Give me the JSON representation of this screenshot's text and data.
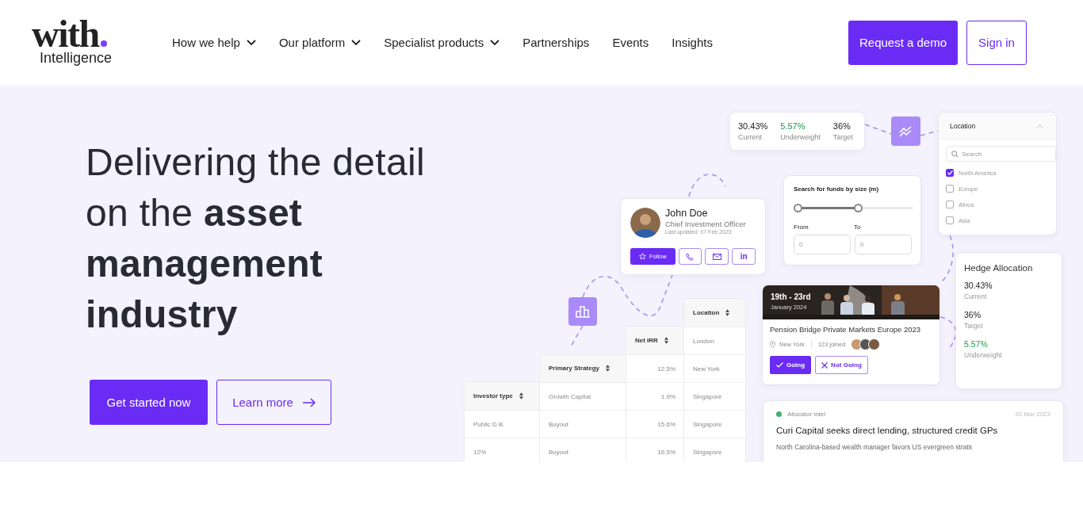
{
  "header": {
    "logo": {
      "word": "with",
      "subtitle": "Intelligence"
    },
    "nav": [
      {
        "label": "How we help",
        "dropdown": true
      },
      {
        "label": "Our platform",
        "dropdown": true
      },
      {
        "label": "Specialist products",
        "dropdown": true
      },
      {
        "label": "Partnerships",
        "dropdown": false
      },
      {
        "label": "Events",
        "dropdown": false
      },
      {
        "label": "Insights",
        "dropdown": false
      }
    ],
    "request_demo": "Request a demo",
    "sign_in": "Sign in"
  },
  "hero": {
    "heading": "Delivering the detail on the **asset management industry**",
    "primary_button": "Get started now",
    "secondary_button": "Learn more"
  },
  "illustration": {
    "stats": [
      {
        "value": "30.43%",
        "label": "Current",
        "highlighted": false
      },
      {
        "value": "5.57%",
        "label": "Underweight",
        "highlighted": true
      },
      {
        "value": "36%",
        "label": "Target",
        "highlighted": false
      }
    ],
    "location_filter": {
      "title": "Location",
      "search_placeholder": "Search",
      "options": [
        {
          "label": "North America",
          "checked": true
        },
        {
          "label": "Europe",
          "checked": false
        },
        {
          "label": "Africa",
          "checked": false
        },
        {
          "label": "Asia",
          "checked": false
        }
      ]
    },
    "fund_size": {
      "title": "Search for funds by size (m)",
      "range": {
        "level": 0.55
      },
      "from_label": "From",
      "to_label": "To",
      "from_placeholder": "0",
      "to_placeholder": "0"
    },
    "profile": {
      "name": "John Doe",
      "role": "Chief Investment Officer",
      "updated": "Last updated: 07 Feb 2023",
      "follow": "Follow",
      "linkedin": "in"
    },
    "event": {
      "date": "19th - 23rd",
      "month": "January 2024",
      "title": "Pension Bridge Private Markets Europe 2023",
      "location": "New York",
      "joined": "123 joined",
      "responses": [
        {
          "label": "Going",
          "kind": "check",
          "selected": true
        },
        {
          "label": "Not Going",
          "kind": "cross",
          "selected": false
        }
      ]
    },
    "hedge": {
      "title": "Hedge Allocation",
      "items": [
        {
          "value": "30.43%",
          "label": "Current",
          "highlighted": false
        },
        {
          "value": "36%",
          "label": "Target",
          "highlighted": false
        },
        {
          "value": "5.57%",
          "label": "Underweight",
          "highlighted": true
        }
      ]
    },
    "table": {
      "columns": [
        {
          "header": "Investor type",
          "cells": [
            "Public D.B.",
            "12%"
          ]
        },
        {
          "header": "Primary Strategy",
          "cells": [
            "Growth Capital",
            "Buyout",
            "Buyout"
          ]
        },
        {
          "header": "Net IRR",
          "cells": [
            "12.5%",
            "1.9%",
            "15.6%",
            "16.5%"
          ]
        },
        {
          "header": "Location",
          "cells": [
            "London",
            "New York",
            "Singapore",
            "Singapore",
            "Singapore"
          ]
        }
      ]
    },
    "news": {
      "tag": "Allocator intel",
      "color": "#3fb36b",
      "date": "30 Mar 2023",
      "headline": "Curi Capital seeks direct lending, structured credit GPs",
      "summary": "North Carolina-based wealth manager favors US evergreen strats"
    }
  }
}
